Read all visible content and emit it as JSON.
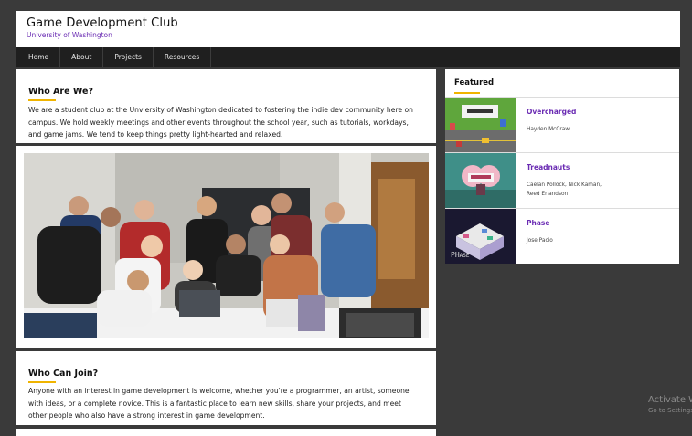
{
  "header": {
    "title": "Game Development Club",
    "subtitle": "University of Washington"
  },
  "nav": {
    "items": [
      "Home",
      "About",
      "Projects",
      "Resources"
    ]
  },
  "about": {
    "title": "Who Are We?",
    "text": "We are a student club at the Unviersity of Washington dedicated to fostering the indie dev community here on campus. We hold weekly meetings and other events throughout the school year, such as tutorials, workdays, and game jams. We tend to keep things pretty light-hearted and relaxed."
  },
  "join": {
    "title": "Who Can Join?",
    "text": "Anyone with an interest in game development is welcome, whether you're a programmer, an artist, someone with ideas, or a complete novice. This is a fantastic place to learn new skills, share your projects, and meet other people who also have a strong interest in game development."
  },
  "featured": {
    "title": "Featured",
    "items": [
      {
        "name": "Overcharged",
        "authors": "Hayden McCraw"
      },
      {
        "name": "Treadnauts",
        "authors": "Caelan Pollock, Nick Kaman, Reed Erlandson"
      },
      {
        "name": "Phase",
        "authors": "Jose Pacio"
      }
    ]
  },
  "watermark": {
    "line1": "Activate W",
    "line2": "Go to Settings"
  },
  "colors": {
    "accent": "#6a2bb3",
    "underline": "#f0b400",
    "nav_bg": "#1f1f1f",
    "page_bg": "#3a3a3a"
  }
}
